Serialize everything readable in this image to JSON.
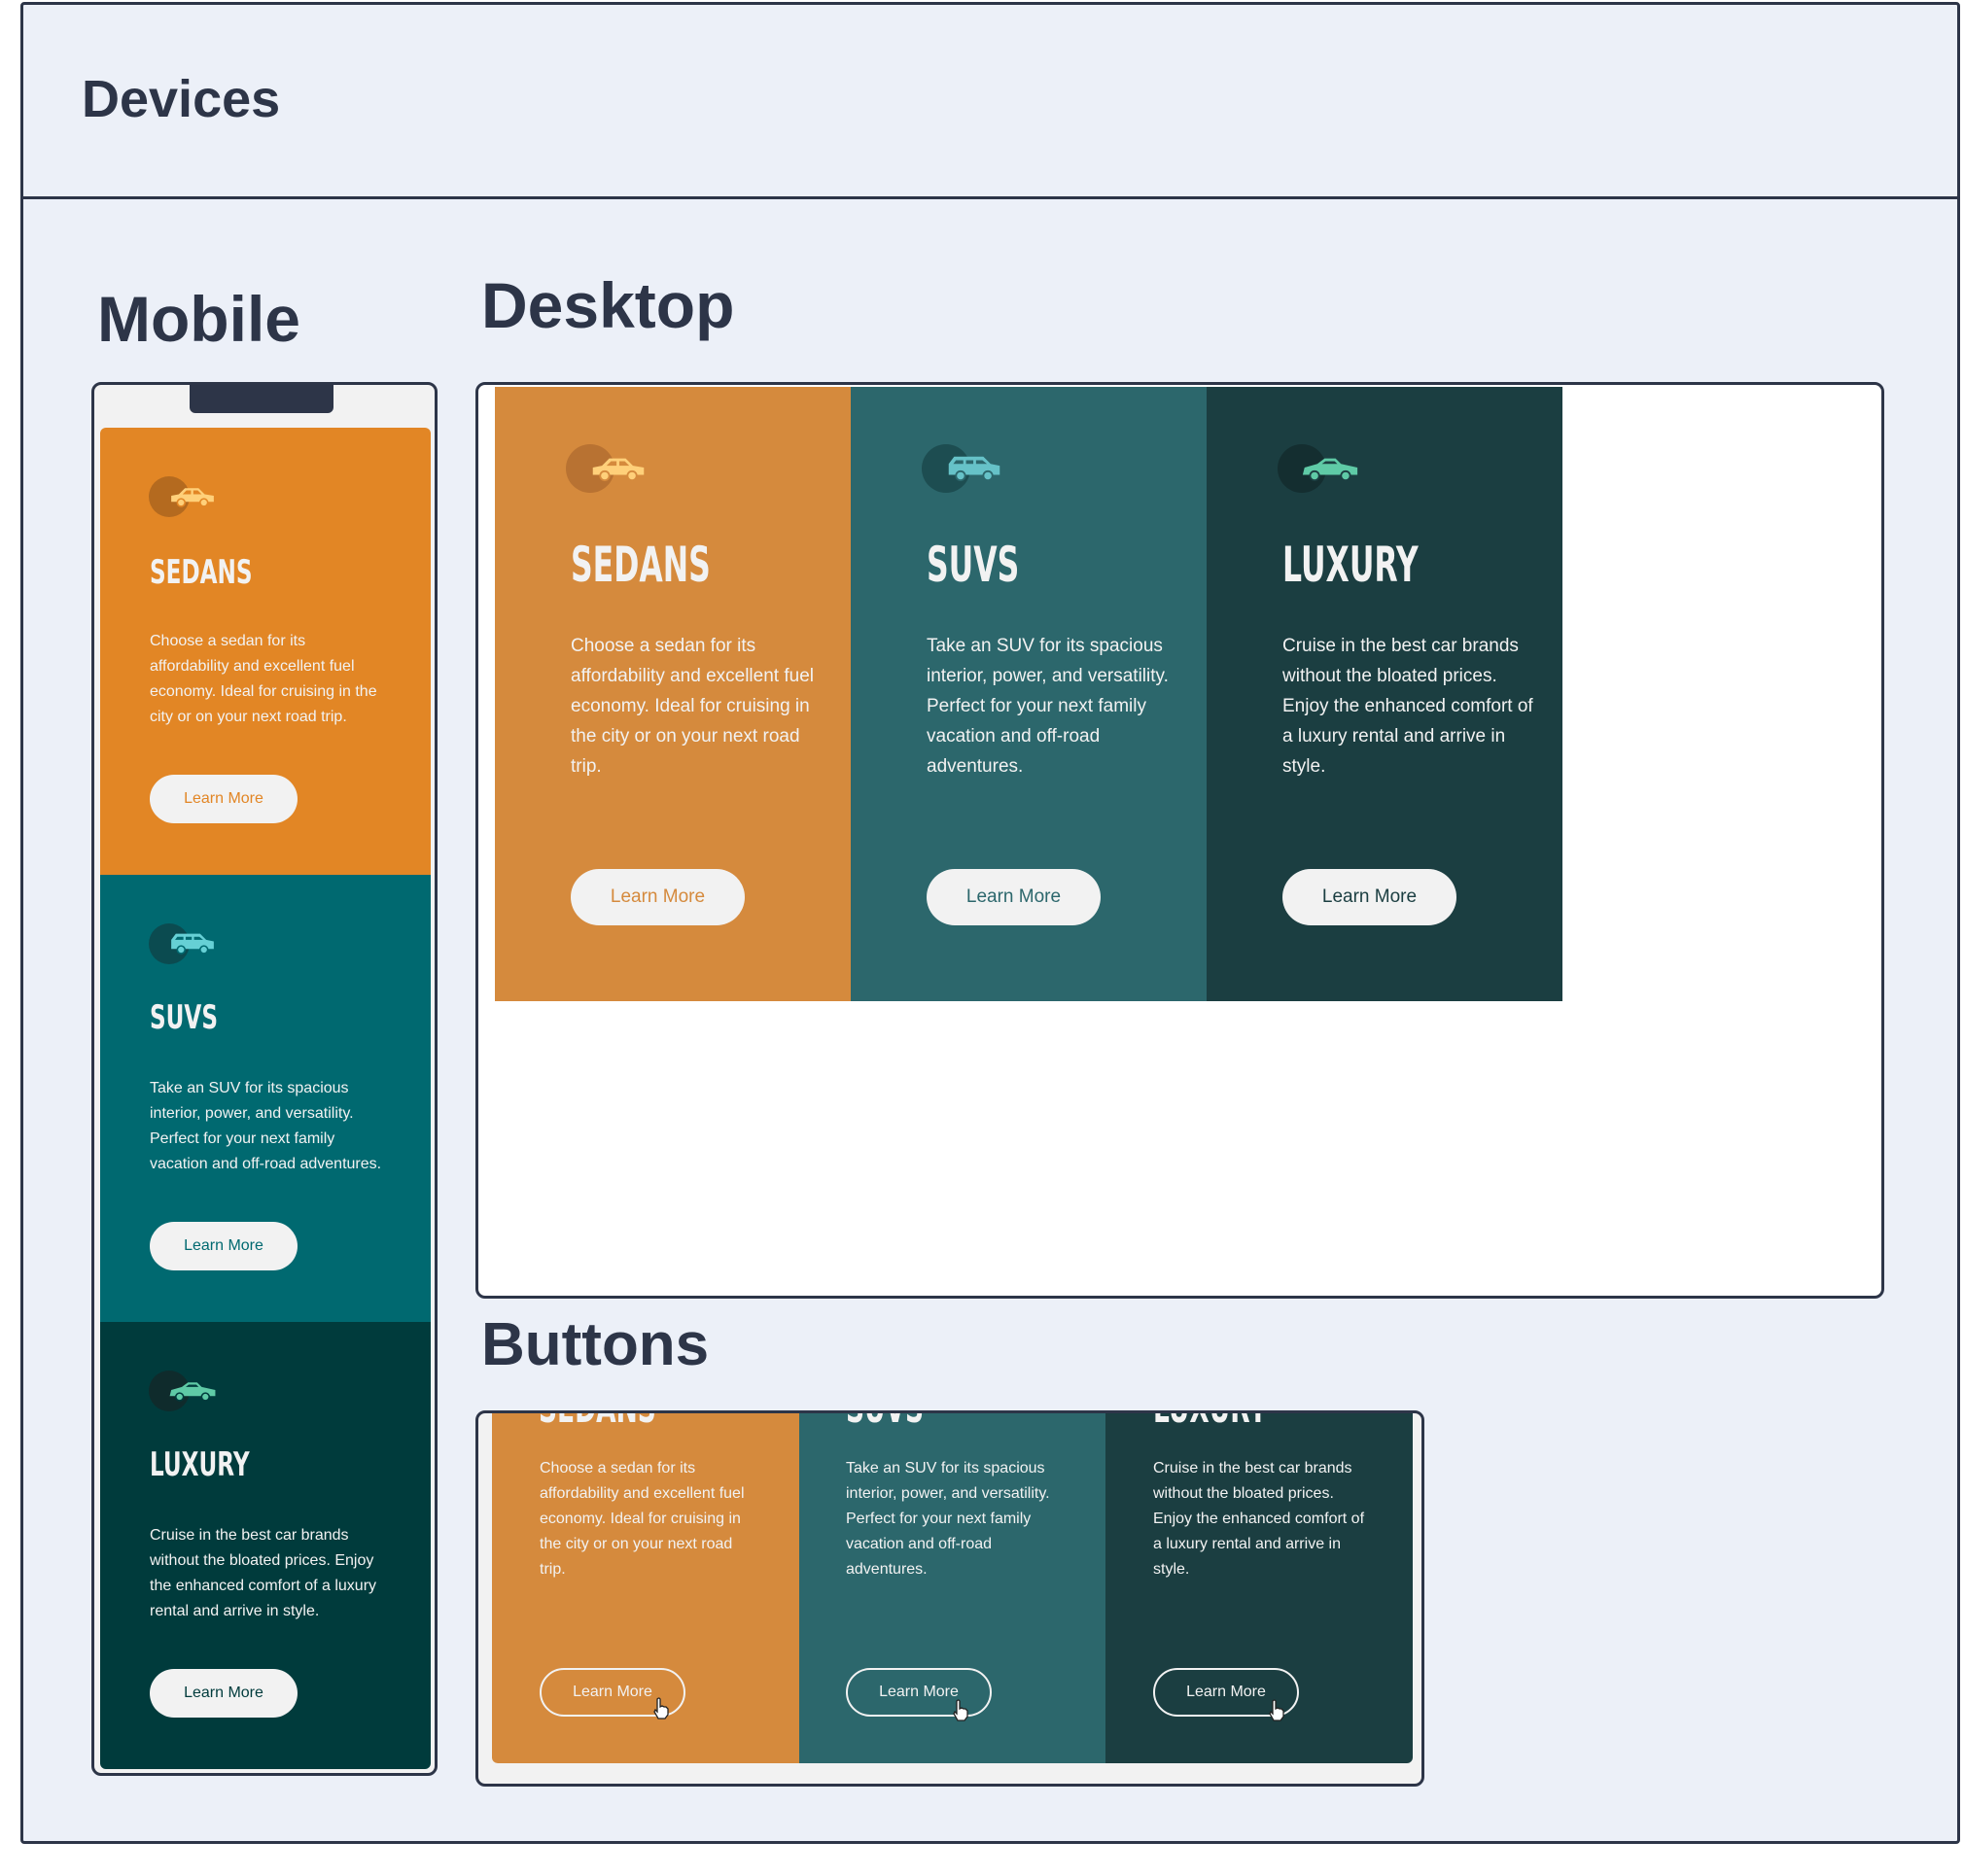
{
  "page": {
    "title": "Devices"
  },
  "sections": {
    "mobile": "Mobile",
    "desktop": "Desktop",
    "buttons": "Buttons"
  },
  "colors": {
    "sedan_mobile": "#e28625",
    "suv_mobile": "#006970",
    "luxury_mobile": "#003b3c",
    "sedan_desktop": "#d58a3d",
    "suv_desktop": "#2c676c",
    "luxury_desktop": "#1b3e41"
  },
  "cards": {
    "sedans": {
      "title": "Sedans",
      "text": "Choose a sedan for its affordability and excellent fuel economy. Ideal for cruising in the city or on your next road trip.",
      "button": "Learn More",
      "icon": "sedan-car-icon"
    },
    "suvs": {
      "title": "SUVs",
      "text": "Take an SUV for its spacious interior, power, and versatility. Perfect for your next family vacation and off-road adventures.",
      "button": "Learn More",
      "icon": "suv-car-icon"
    },
    "luxury": {
      "title": "Luxury",
      "text": "Cruise in the best car brands without the bloated prices. Enjoy the enhanced comfort of a luxury rental and arrive in style.",
      "button": "Learn More",
      "icon": "luxury-car-icon"
    }
  }
}
